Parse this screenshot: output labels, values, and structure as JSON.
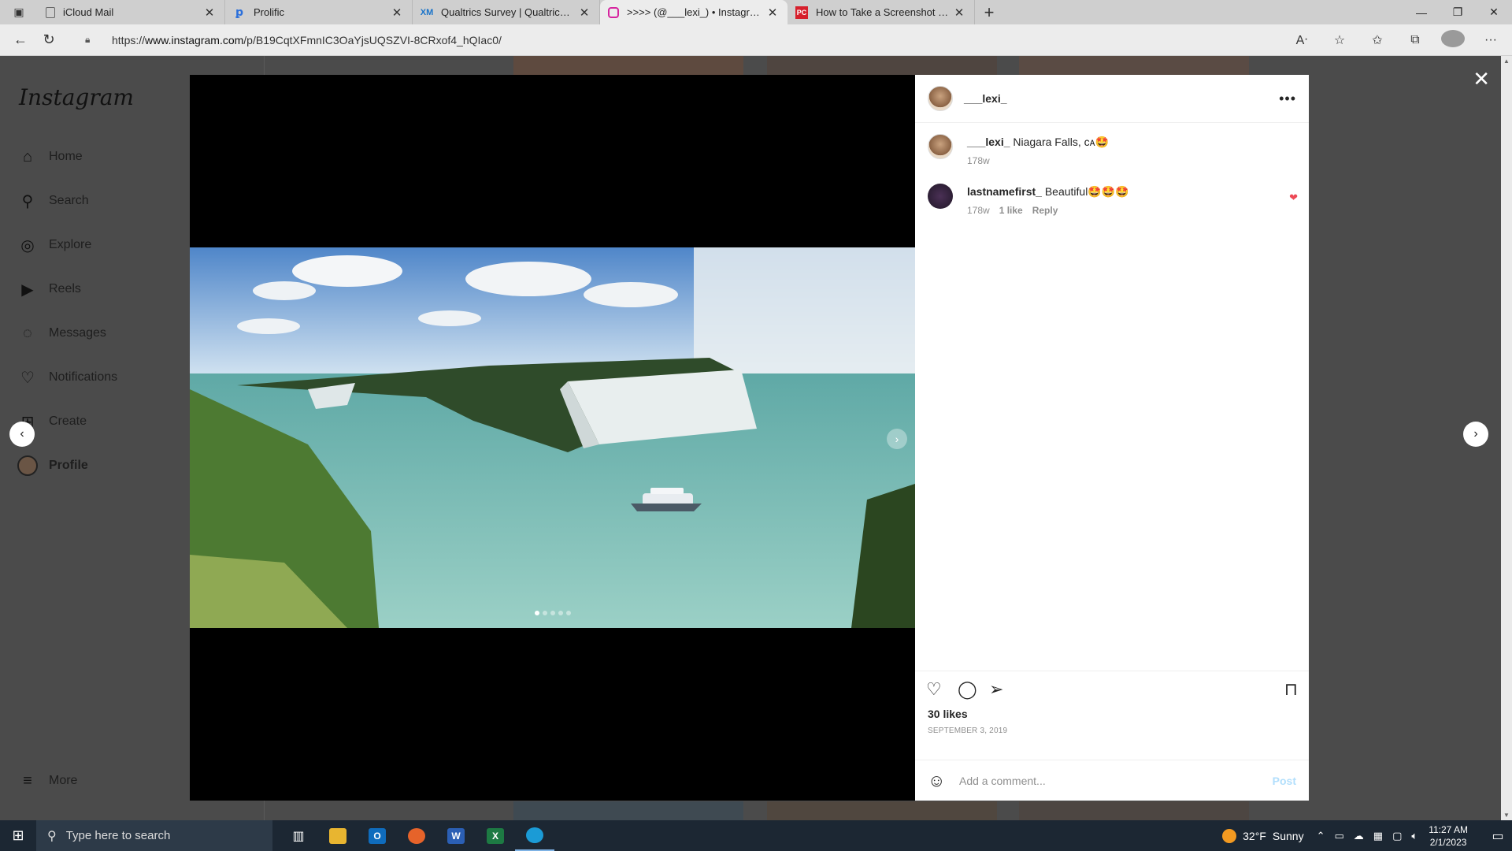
{
  "browser": {
    "tabs": [
      {
        "title": "iCloud Mail",
        "favicon": "doc-icon",
        "favcolor": "#555555"
      },
      {
        "title": "Prolific",
        "favicon": "prolific-icon",
        "favcolor": "#2a6fdb"
      },
      {
        "title": "Qualtrics Survey | Qualtrics Experience",
        "favicon": "qualtrics-icon",
        "favcolor": "#1a73c9"
      },
      {
        "title": ">>>> (@___lexi_) • Instagram photos",
        "favicon": "instagram-icon",
        "favcolor": "#d6249f",
        "active": true
      },
      {
        "title": "How to Take a Screenshot on Any",
        "favicon": "pcmag-icon",
        "favcolor": "#d6202c"
      }
    ],
    "url_prefix": "https://",
    "url_domain": "www.instagram.com",
    "url_path": "/p/B19CqtXFmnIC3OaYjsUQSZVI-8CRxof4_hQIac0/"
  },
  "sidebar": {
    "logo": "Instagram",
    "items": [
      {
        "label": "Home",
        "icon": "home-icon",
        "glyph": "⌂"
      },
      {
        "label": "Search",
        "icon": "search-icon",
        "glyph": "⚲"
      },
      {
        "label": "Explore",
        "icon": "compass-icon",
        "glyph": "◎"
      },
      {
        "label": "Reels",
        "icon": "reels-icon",
        "glyph": "▶"
      },
      {
        "label": "Messages",
        "icon": "messenger-icon",
        "glyph": "◌"
      },
      {
        "label": "Notifications",
        "icon": "heart-icon",
        "glyph": "♡"
      },
      {
        "label": "Create",
        "icon": "plus-square-icon",
        "glyph": "⊞"
      },
      {
        "label": "Profile",
        "icon": "profile-avatar",
        "glyph": ""
      }
    ],
    "more": "More"
  },
  "post": {
    "username": "___lexi_",
    "caption_user": "___lexi_",
    "caption_text": "Niagara Falls, ᴄᴀ🤩",
    "caption_time": "178w",
    "comments": [
      {
        "user": "lastnamefirst_",
        "text": "Beautiful🤩🤩🤩",
        "time": "178w",
        "likes": "1 like",
        "reply": "Reply"
      }
    ],
    "likes": "30 likes",
    "date": "SEPTEMBER 3, 2019",
    "comment_placeholder": "Add a comment...",
    "post_label": "Post",
    "carousel_count": 5,
    "carousel_active": 0
  },
  "taskbar": {
    "search_placeholder": "Type here to search",
    "weather_temp": "32°F",
    "weather_desc": "Sunny",
    "time": "11:27 AM",
    "date": "2/1/2023"
  }
}
